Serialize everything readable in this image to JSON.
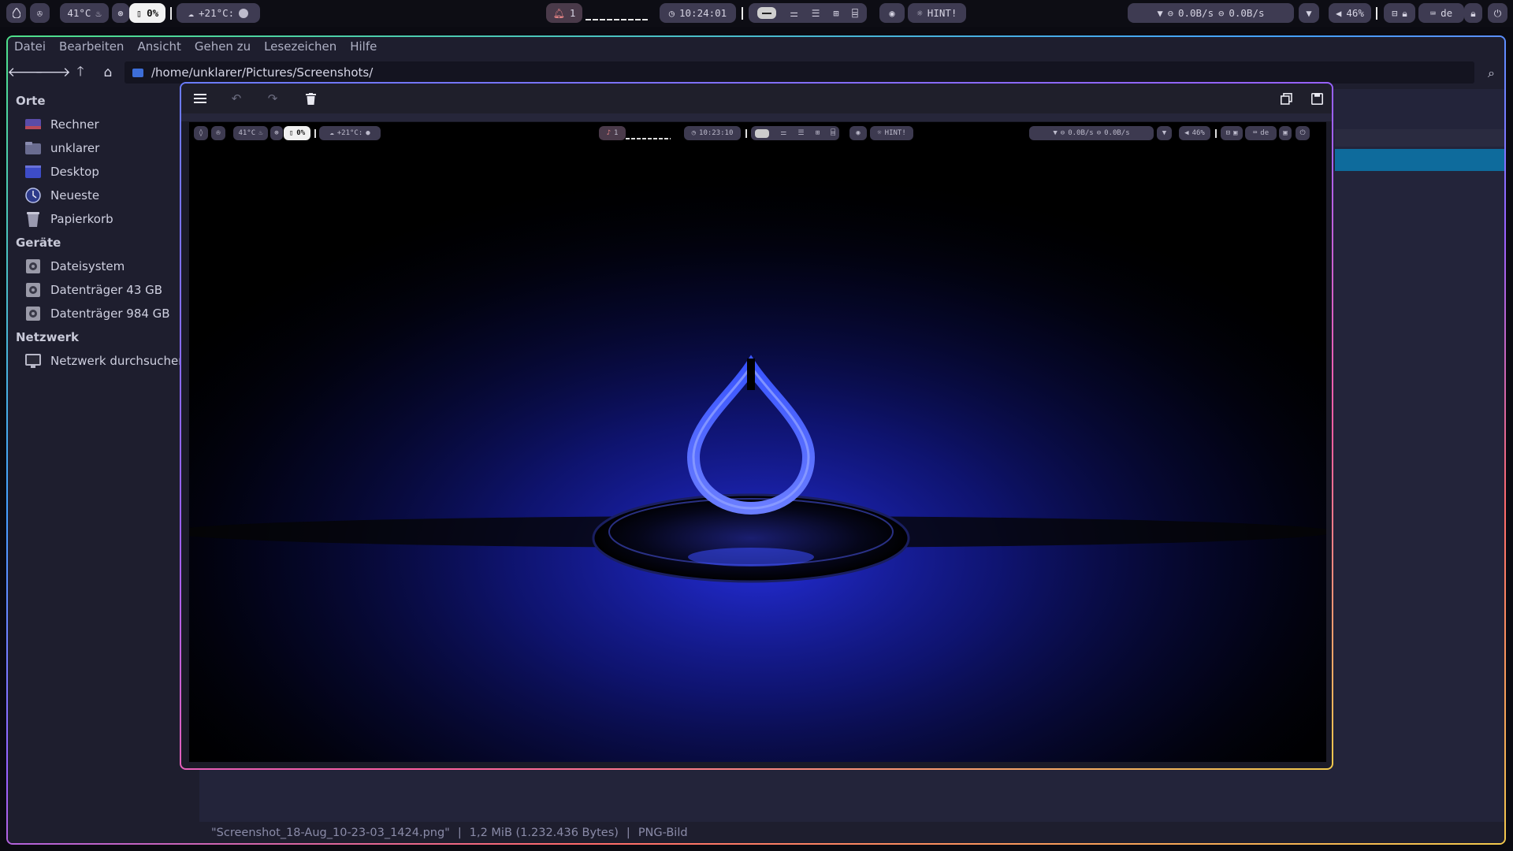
{
  "topbar": {
    "cpu_temp": "41°C",
    "cpu_usage": "0%",
    "weather": "+21°C:",
    "notifications": "1",
    "clock": "10:24:01",
    "hint": "HINT!",
    "net_down": "0.0B/s",
    "net_up": "0.0B/s",
    "volume": "46%",
    "kb_layout": "de"
  },
  "file_manager": {
    "menu": [
      "Datei",
      "Bearbeiten",
      "Ansicht",
      "Gehen zu",
      "Lesezeichen",
      "Hilfe"
    ],
    "path": "/home/unklarer/Pictures/Screenshots/",
    "sidebar": {
      "places_title": "Orte",
      "places": [
        "Rechner",
        "unklarer",
        "Desktop",
        "Neueste",
        "Papierkorb"
      ],
      "devices_title": "Geräte",
      "devices": [
        "Dateisystem",
        "Datenträger 43 GB",
        "Datenträger 984 GB"
      ],
      "network_title": "Netzwerk",
      "network": [
        "Netzwerk durchsuchen"
      ]
    },
    "status": {
      "filename": "\"Screenshot_18-Aug_10-23-03_1424.png\"",
      "size": "1,2 MiB (1.232.436 Bytes)",
      "type": "PNG-Bild"
    }
  },
  "viewer": {
    "mini_topbar": {
      "cpu_temp": "41°C",
      "cpu_usage": "0%",
      "weather": "+21°C:",
      "notifications": "1",
      "clock": "10:23:10",
      "hint": "HINT!",
      "net_down": "0.0B/s",
      "net_up": "0.0B/s",
      "volume": "46%",
      "kb_layout": "de"
    }
  },
  "colors": {
    "accent_selection": "#0e6b9c",
    "pill_bg": "#3e3b52",
    "wallpaper_glow": "#1f2bff"
  }
}
